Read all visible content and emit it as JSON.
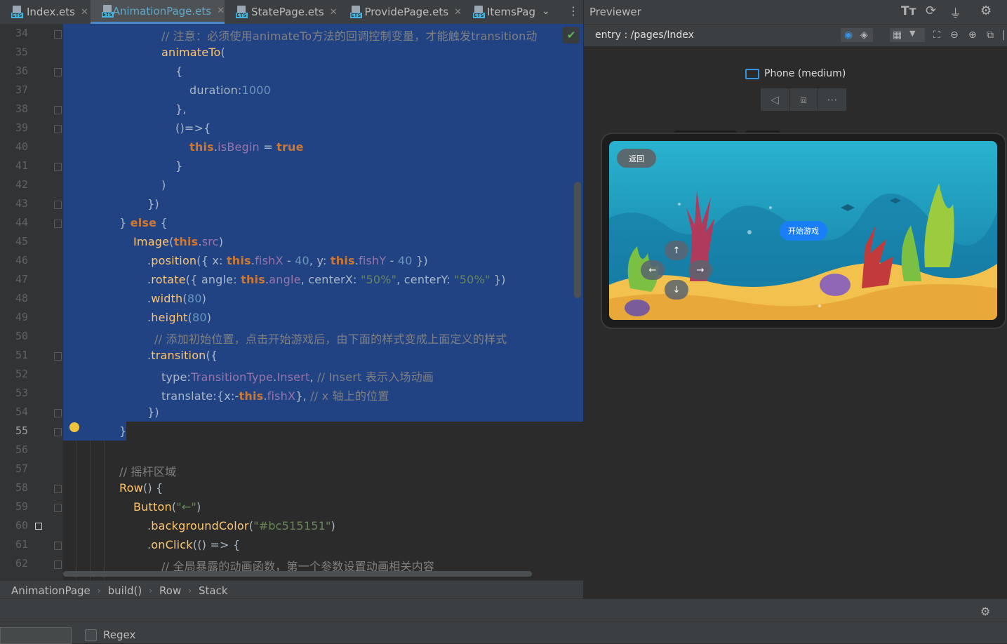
{
  "tabs": [
    {
      "label": "Index.ets",
      "active": false
    },
    {
      "label": "AnimationPage.ets",
      "active": true
    },
    {
      "label": "StatePage.ets",
      "active": false
    },
    {
      "label": "ProvidePage.ets",
      "active": false
    },
    {
      "label": "ItemsPag",
      "active": false
    }
  ],
  "tab_more_icon": "chevron-down-icon",
  "tab_menu_icon": "kebab-menu-icon",
  "line_numbers": [
    "34",
    "35",
    "36",
    "37",
    "38",
    "39",
    "40",
    "41",
    "42",
    "43",
    "44",
    "45",
    "46",
    "47",
    "48",
    "49",
    "50",
    "51",
    "52",
    "53",
    "54",
    "55",
    "56",
    "57",
    "58",
    "59",
    "60",
    "61",
    "62"
  ],
  "current_line": "55",
  "breadcrumb": [
    "AnimationPage",
    "build()",
    "Row",
    "Stack"
  ],
  "previewer": {
    "title": "Previewer",
    "route": "entry : /pages/Index",
    "device": "Phone (medium)",
    "app": {
      "back_label": "返回",
      "start_label": "开始游戏",
      "up_label": "↑",
      "down_label": "↓",
      "left_label": "←",
      "right_label": "→"
    }
  },
  "find": {
    "regex_label": "Regex",
    "regex_checked": false
  },
  "colors": {
    "selection": "#214283",
    "keyword": "#cc7832",
    "string": "#6a8759",
    "number": "#6897bb",
    "accent": "#1a7ef8"
  }
}
